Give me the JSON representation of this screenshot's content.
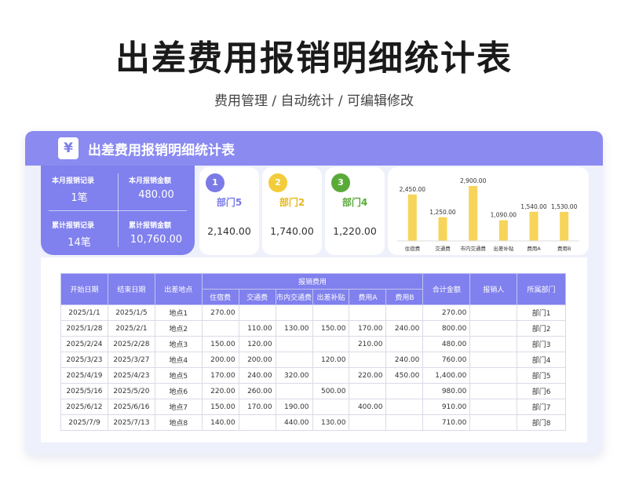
{
  "page": {
    "title": "出差费用报销明细统计表",
    "subtitle": "费用管理 /  自动统计  /  可编辑修改"
  },
  "header": {
    "icon": "yen-icon",
    "icon_glyph": "¥",
    "title": "出差费用报销明细统计表"
  },
  "summary": {
    "month_records_label": "本月报销记录",
    "month_records_value": "1笔",
    "month_amount_label": "本月报销金额",
    "month_amount_value": "480.00",
    "total_records_label": "累计报销记录",
    "total_records_value": "14笔",
    "total_amount_label": "累计报销金额",
    "total_amount_value": "10,760.00"
  },
  "top_departments": [
    {
      "rank": "1",
      "name": "部门5",
      "amount": "2,140.00",
      "color": "#7b7be8"
    },
    {
      "rank": "2",
      "name": "部门2",
      "amount": "1,740.00",
      "color": "#f2cc3a"
    },
    {
      "rank": "3",
      "name": "部门4",
      "amount": "1,220.00",
      "color": "#5aaa3a"
    }
  ],
  "chart_data": {
    "type": "bar",
    "categories": [
      "住宿费",
      "交通费",
      "市内交通费",
      "出差补贴",
      "费用A",
      "费用B"
    ],
    "values": [
      2450,
      1250,
      2900,
      1090,
      1540,
      1530
    ],
    "labels": [
      "2,450.00",
      "1,250.00",
      "2,900.00",
      "1,090.00",
      "1,540.00",
      "1,530.00"
    ],
    "ylim": [
      0,
      2900
    ],
    "bar_color": "#f7d45a",
    "grid": false
  },
  "table": {
    "headers": {
      "start_date": "开始日期",
      "end_date": "结束日期",
      "location": "出差地点",
      "expense_group": "报销费用",
      "total": "合计金额",
      "person": "报销人",
      "department": "所属部门"
    },
    "sub_headers": [
      "住宿费",
      "交通费",
      "市内交通费",
      "出差补贴",
      "费用A",
      "费用B"
    ],
    "rows": [
      [
        "2025/1/1",
        "2025/1/5",
        "地点1",
        "270.00",
        "",
        "",
        "",
        "",
        "",
        "270.00",
        "",
        "部门1"
      ],
      [
        "2025/1/28",
        "2025/2/1",
        "地点2",
        "",
        "110.00",
        "130.00",
        "150.00",
        "170.00",
        "240.00",
        "800.00",
        "",
        "部门2"
      ],
      [
        "2025/2/24",
        "2025/2/28",
        "地点3",
        "150.00",
        "120.00",
        "",
        "",
        "210.00",
        "",
        "480.00",
        "",
        "部门3"
      ],
      [
        "2025/3/23",
        "2025/3/27",
        "地点4",
        "200.00",
        "200.00",
        "",
        "120.00",
        "",
        "240.00",
        "760.00",
        "",
        "部门4"
      ],
      [
        "2025/4/19",
        "2025/4/23",
        "地点5",
        "170.00",
        "240.00",
        "320.00",
        "",
        "220.00",
        "450.00",
        "1,400.00",
        "",
        "部门5"
      ],
      [
        "2025/5/16",
        "2025/5/20",
        "地点6",
        "220.00",
        "260.00",
        "",
        "500.00",
        "",
        "",
        "980.00",
        "",
        "部门6"
      ],
      [
        "2025/6/12",
        "2025/6/16",
        "地点7",
        "150.00",
        "170.00",
        "190.00",
        "",
        "400.00",
        "",
        "910.00",
        "",
        "部门7"
      ],
      [
        "2025/7/9",
        "2025/7/13",
        "地点8",
        "140.00",
        "",
        "440.00",
        "130.00",
        "",
        "",
        "710.00",
        "",
        "部门8"
      ]
    ]
  }
}
